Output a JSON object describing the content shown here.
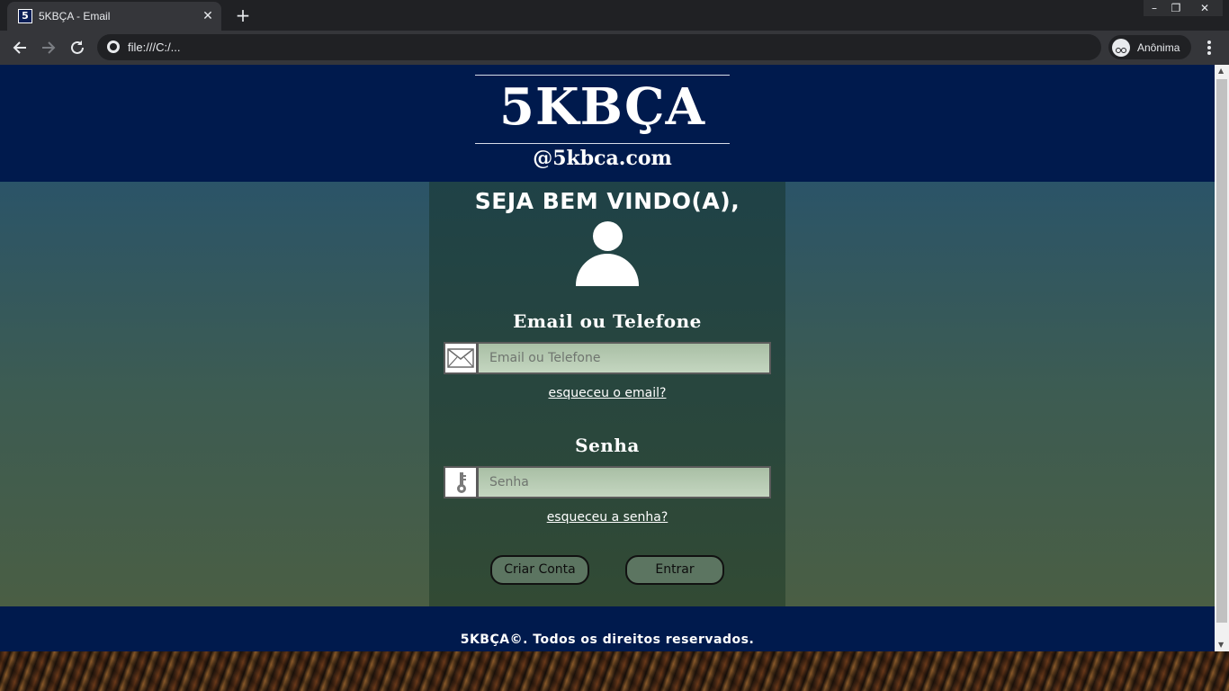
{
  "browser": {
    "tab_favicon": "5",
    "tab_title": "5KBÇA - Email",
    "tab_close_icon": "✕",
    "new_tab_icon": "+",
    "url": "file:///C:/...",
    "incognito_label": "Anônima",
    "window_controls": {
      "minimize": "–",
      "restore": "❐",
      "close": "✕"
    }
  },
  "header": {
    "logo_title": "5KBÇA",
    "logo_subtitle": "@5kbca.com",
    "background_color": "#001a4d"
  },
  "login": {
    "welcome": "SEJA BEM VINDO(A),",
    "avatar_icon": "user-icon",
    "email": {
      "label": "Email ou Telefone",
      "placeholder": "Email ou Telefone",
      "value": "",
      "icon": "envelope-icon",
      "forgot_link": "esqueceu o email?"
    },
    "password": {
      "label": "Senha",
      "placeholder": "Senha",
      "value": "",
      "icon": "key-icon",
      "forgot_link": "esqueceu a senha?"
    },
    "buttons": {
      "create_account": "Criar Conta",
      "login": "Entrar"
    }
  },
  "footer": {
    "text": "5KBÇA©. Todos os direitos reservados."
  }
}
